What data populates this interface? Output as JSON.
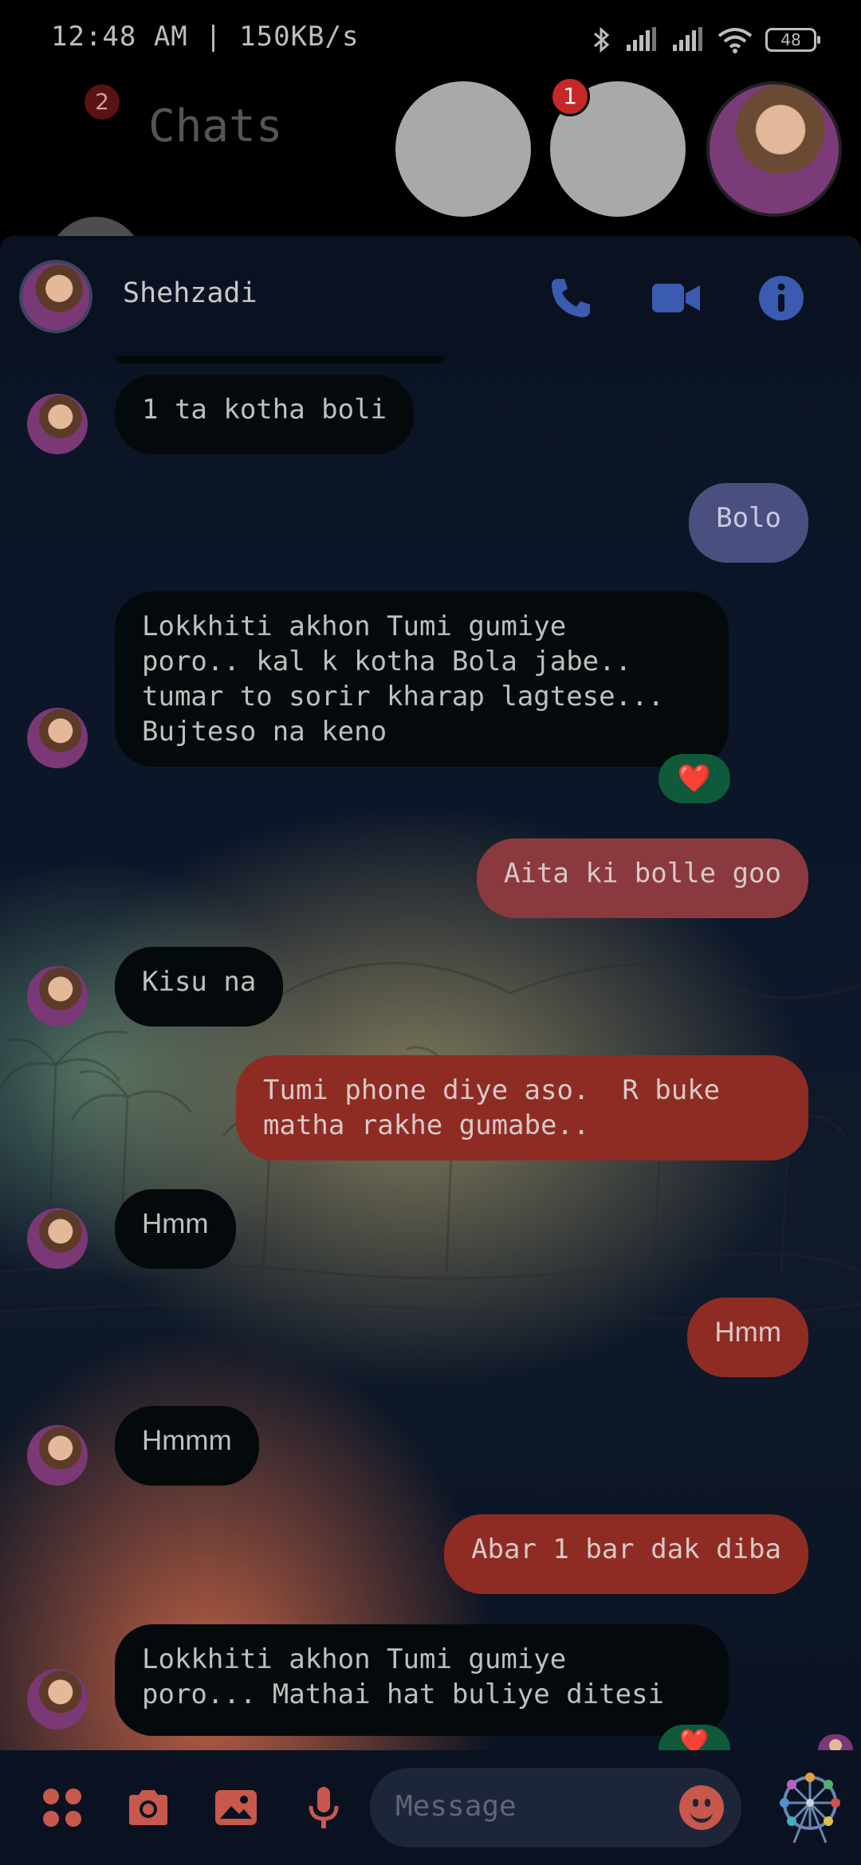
{
  "status_bar": {
    "time_speed": "12:48 AM | 150KB/s",
    "battery": "48"
  },
  "chats_header": {
    "title": "Chats",
    "menu_badge": "2",
    "story_badge": "1"
  },
  "conversation": {
    "contact_name": "Shehzadi"
  },
  "messages": [
    {
      "side": "in",
      "text": "1 ta kotha boli"
    },
    {
      "side": "out",
      "text": "Bolo"
    },
    {
      "side": "in",
      "text": "Lokkhiti akhon Tumi gumiye\nporo.. kal k kotha Bola jabe..\ntumar to sorir kharap lagtese...\nBujteso na keno",
      "reaction": "❤️"
    },
    {
      "side": "out",
      "text": "Aita ki bolle goo"
    },
    {
      "side": "in",
      "text": "Kisu na"
    },
    {
      "side": "out",
      "text": "Tumi phone diye aso.  R buke\nmatha rakhe gumabe.."
    },
    {
      "side": "in",
      "text": "Hmm"
    },
    {
      "side": "out",
      "text": "Hmm"
    },
    {
      "side": "in",
      "text": "Hmmm"
    },
    {
      "side": "out",
      "text": "Abar 1 bar dak diba"
    },
    {
      "side": "in",
      "text": "Lokkhiti akhon Tumi gumiye\nporo... Mathai hat buliye ditesi",
      "reaction": "❤️"
    }
  ],
  "composer": {
    "placeholder": "Message"
  },
  "colors": {
    "accent_blue": "#3b5bb0",
    "accent_red": "#c8584c",
    "bubble_out_red": "#8e2c24",
    "bubble_out_blue": "#4b4f80"
  }
}
